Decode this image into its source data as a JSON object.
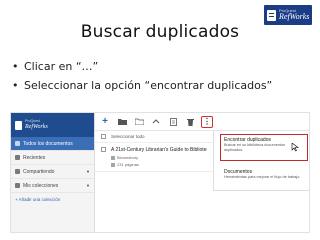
{
  "slide": {
    "title": "Buscar duplicados",
    "bullets": [
      "Clicar en “…”",
      "Seleccionar la opción “encontrar duplicados”"
    ]
  },
  "logo": {
    "line1": "ProQuest",
    "line2": "RefWorks"
  },
  "app": {
    "sidebar": {
      "logo": {
        "line1": "ProQuest",
        "line2": "RefWorks"
      },
      "items": [
        {
          "label": "Todos los documentos",
          "active": true
        },
        {
          "label": "Recientes",
          "active": false
        },
        {
          "label": "Compartiendo",
          "active": false
        },
        {
          "label": "Mis colecciones",
          "active": false
        }
      ],
      "add_collection": "+ Añadir una colección"
    },
    "toolbar": {
      "buttons": [
        "plus-icon",
        "folder-icon",
        "folder-add-icon",
        "share-icon",
        "quote-icon",
        "trash-icon",
        "more-icon"
      ],
      "more_label": "⋮"
    },
    "list": {
      "select_all": "Seleccionar todo",
      "items": [
        {
          "title": "A 21st-Century Librarian's Guide to Biblioteca",
          "meta1": "Bloomsbury",
          "meta2": "231 páginas"
        }
      ]
    },
    "menu": {
      "find_duplicates": {
        "title": "Encontrar duplicados",
        "desc": "Buscar en su biblioteca documentos duplicados."
      },
      "documents": {
        "title": "Documentos",
        "desc": "Herramientas para mejorar el flujo de trabajo."
      }
    },
    "colors": {
      "brand": "#1e4c8f",
      "active": "#3a6fb8",
      "highlight": "#c62828"
    }
  }
}
